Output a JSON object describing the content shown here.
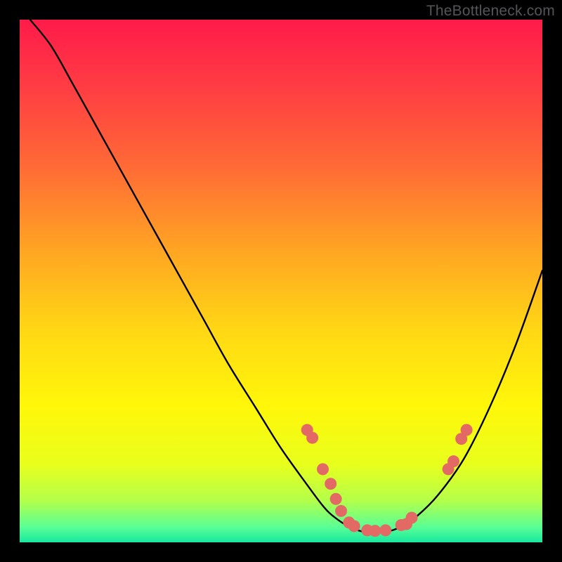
{
  "watermark": "TheBottleneck.com",
  "colors": {
    "frame": "#000000",
    "curve": "#000000",
    "dots": "#e36965",
    "gradient_stops": [
      {
        "offset": 0.0,
        "color": "#ff1b4a"
      },
      {
        "offset": 0.12,
        "color": "#ff3a44"
      },
      {
        "offset": 0.28,
        "color": "#ff6a36"
      },
      {
        "offset": 0.45,
        "color": "#ffa822"
      },
      {
        "offset": 0.6,
        "color": "#ffd914"
      },
      {
        "offset": 0.74,
        "color": "#fff70a"
      },
      {
        "offset": 0.85,
        "color": "#e8ff1c"
      },
      {
        "offset": 0.92,
        "color": "#b4ff4a"
      },
      {
        "offset": 0.97,
        "color": "#5bff94"
      },
      {
        "offset": 1.0,
        "color": "#17e8a0"
      }
    ]
  },
  "chart_data": {
    "type": "line",
    "title": "",
    "xlabel": "",
    "ylabel": "",
    "xlim": [
      0,
      100
    ],
    "ylim": [
      0,
      100
    ],
    "series": [
      {
        "name": "bottleneck-curve",
        "x": [
          2,
          6,
          10,
          15,
          20,
          25,
          30,
          35,
          40,
          45,
          50,
          55,
          58,
          60,
          63,
          66,
          70,
          73,
          76,
          80,
          85,
          90,
          95,
          100
        ],
        "y": [
          100,
          95,
          88,
          79,
          70,
          61,
          52,
          43,
          34,
          26,
          18,
          11,
          7,
          5,
          3,
          2,
          2,
          3,
          5,
          9,
          16,
          26,
          38,
          52
        ]
      }
    ],
    "dots": [
      {
        "x": 55.0,
        "y": 21.5
      },
      {
        "x": 56.0,
        "y": 20.0
      },
      {
        "x": 58.0,
        "y": 14.0
      },
      {
        "x": 59.5,
        "y": 11.2
      },
      {
        "x": 60.5,
        "y": 8.3
      },
      {
        "x": 61.5,
        "y": 6.0
      },
      {
        "x": 63.0,
        "y": 3.8
      },
      {
        "x": 64.0,
        "y": 3.1
      },
      {
        "x": 66.5,
        "y": 2.3
      },
      {
        "x": 68.0,
        "y": 2.2
      },
      {
        "x": 70.0,
        "y": 2.3
      },
      {
        "x": 73.0,
        "y": 3.3
      },
      {
        "x": 74.0,
        "y": 3.5
      },
      {
        "x": 75.0,
        "y": 4.7
      },
      {
        "x": 82.0,
        "y": 14.0
      },
      {
        "x": 83.0,
        "y": 15.5
      },
      {
        "x": 84.5,
        "y": 19.8
      },
      {
        "x": 85.5,
        "y": 21.5
      }
    ]
  }
}
